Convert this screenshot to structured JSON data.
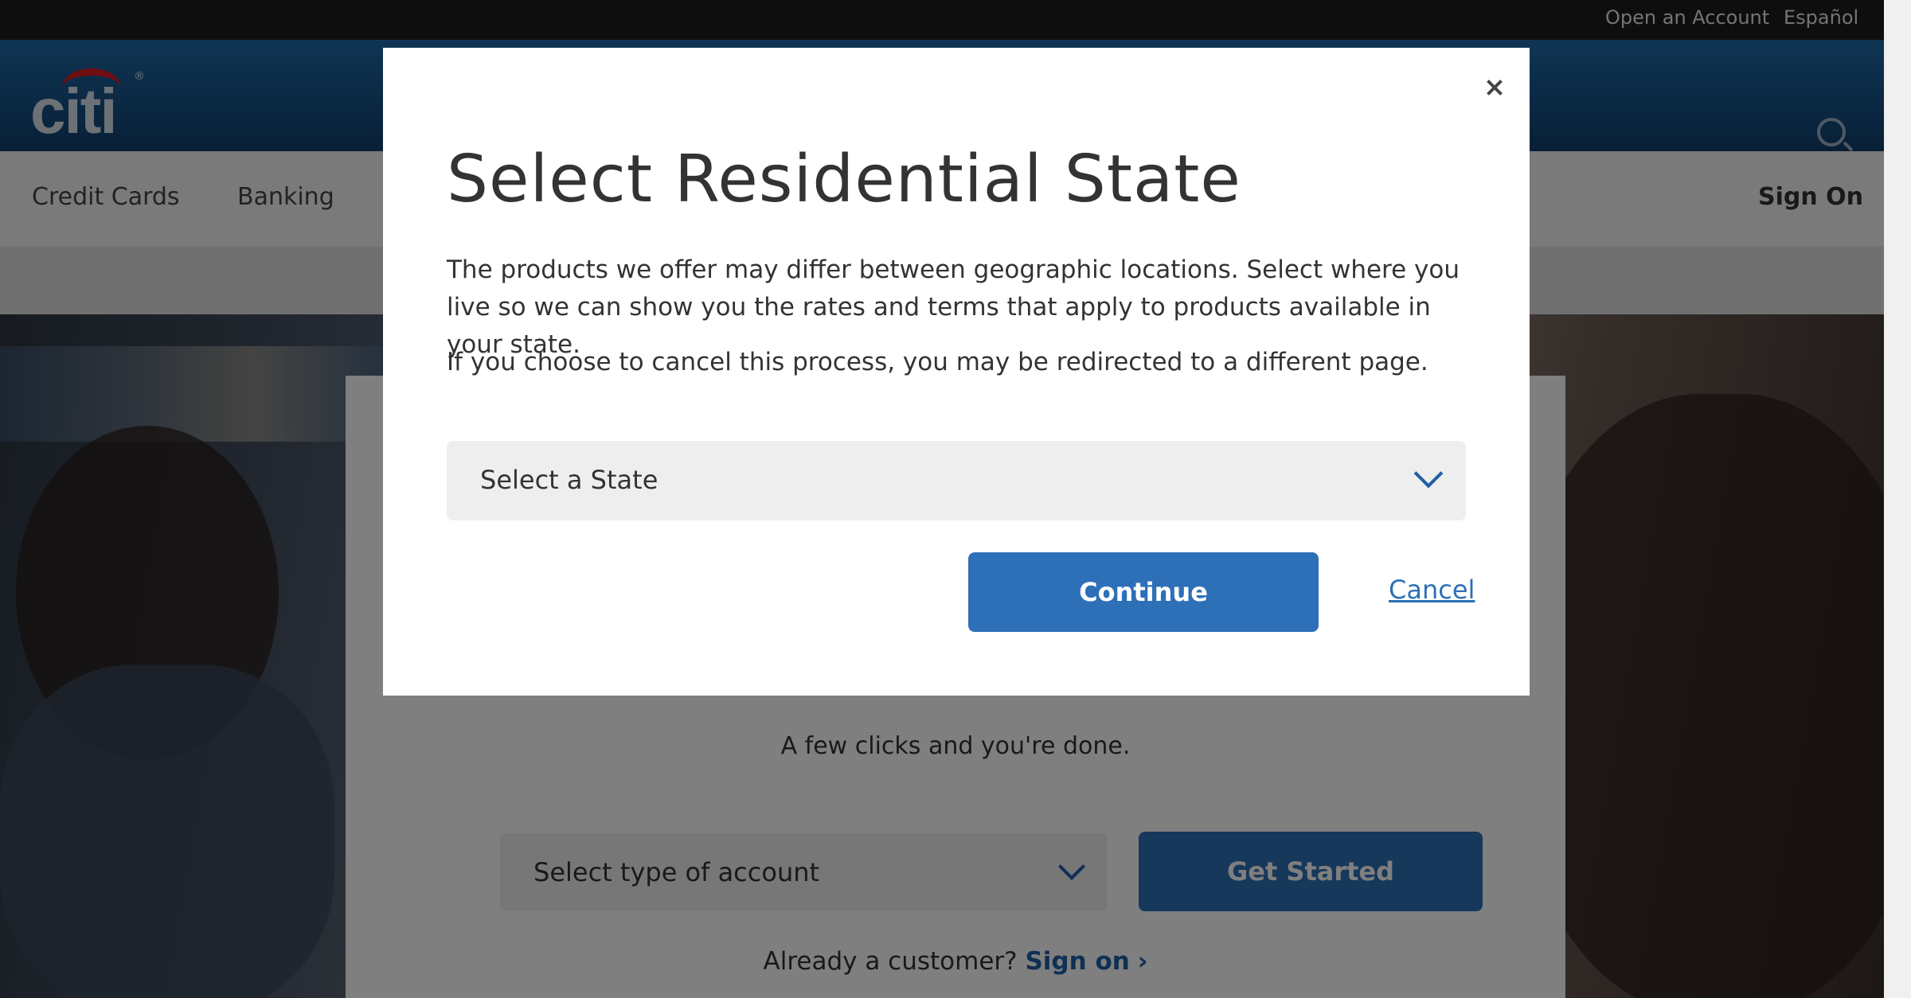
{
  "utility_nav": {
    "open_account": "Open an Account",
    "language": "Español"
  },
  "header": {
    "logo_text": "citi",
    "logo_mark": "®"
  },
  "main_nav": {
    "items": [
      "Credit Cards",
      "Banking"
    ],
    "sign_on": "Sign On"
  },
  "hero": {
    "subtitle": "A few clicks and you're done.",
    "account_select": {
      "placeholder": "Select type of account"
    },
    "get_started": "Get Started",
    "already_customer": "Already a customer?",
    "sign_on_link": "Sign on",
    "sign_on_chevron": "›"
  },
  "modal": {
    "title": "Select Residential State",
    "description": "The products we offer may differ between geographic locations. Select where you live so we can show you the rates and terms that apply to products available in your state.",
    "note": "If you choose to cancel this process, you may be redirected to a different page.",
    "state_select": {
      "value": "Select a State"
    },
    "continue": "Continue",
    "cancel": "Cancel",
    "close_symbol": "×"
  },
  "colors": {
    "brand_blue": "#2d70b7",
    "header_blue": "#1f6aa8",
    "logo_red": "#e11b22",
    "topbar_black": "#1d1d1d"
  },
  "icons": [
    "search-icon",
    "close-icon",
    "chevron-down-icon"
  ]
}
